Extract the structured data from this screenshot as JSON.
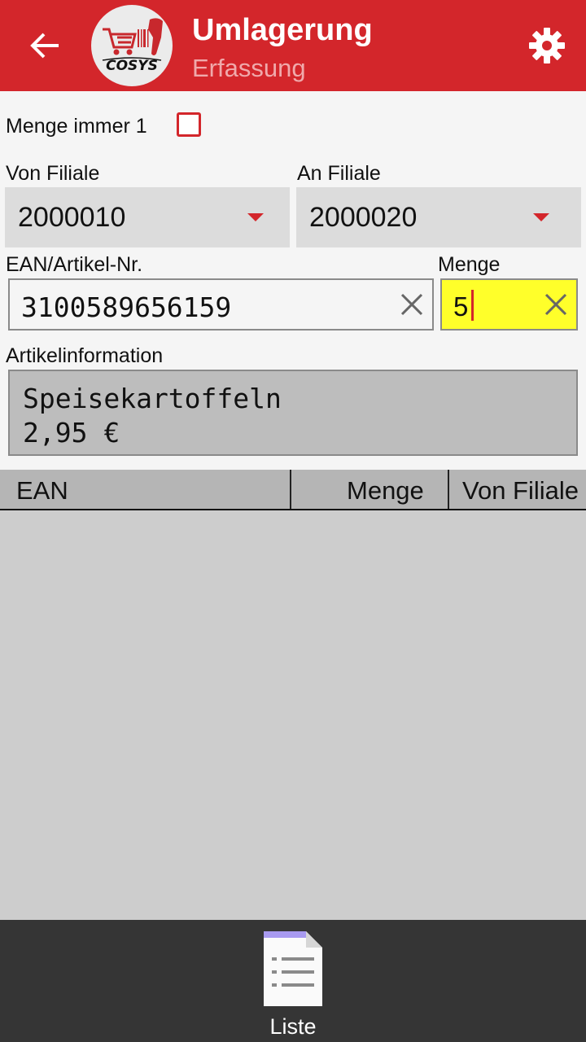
{
  "header": {
    "title": "Umlagerung",
    "subtitle": "Erfassung",
    "back_icon": "arrow-back-icon",
    "settings_icon": "gear-icon",
    "logo_text": "COSYS",
    "accent_color": "#d3262b"
  },
  "form": {
    "menge_immer_1_label": "Menge immer 1",
    "menge_immer_1_checked": false,
    "von_filiale_label": "Von Filiale",
    "von_filiale_value": "2000010",
    "an_filiale_label": "An Filiale",
    "an_filiale_value": "2000020",
    "ean_label": "EAN/Artikel-Nr.",
    "ean_value": "3100589656159",
    "menge_label": "Menge",
    "menge_value": "5",
    "artikelinfo_label": "Artikelinformation",
    "artikel_name": "Speisekartoffeln",
    "artikel_preis": "2,95 €"
  },
  "table": {
    "columns": [
      "EAN",
      "Menge",
      "Von Filiale"
    ],
    "rows": []
  },
  "bottom_nav": {
    "liste_label": "Liste",
    "liste_icon": "document-list-icon"
  }
}
